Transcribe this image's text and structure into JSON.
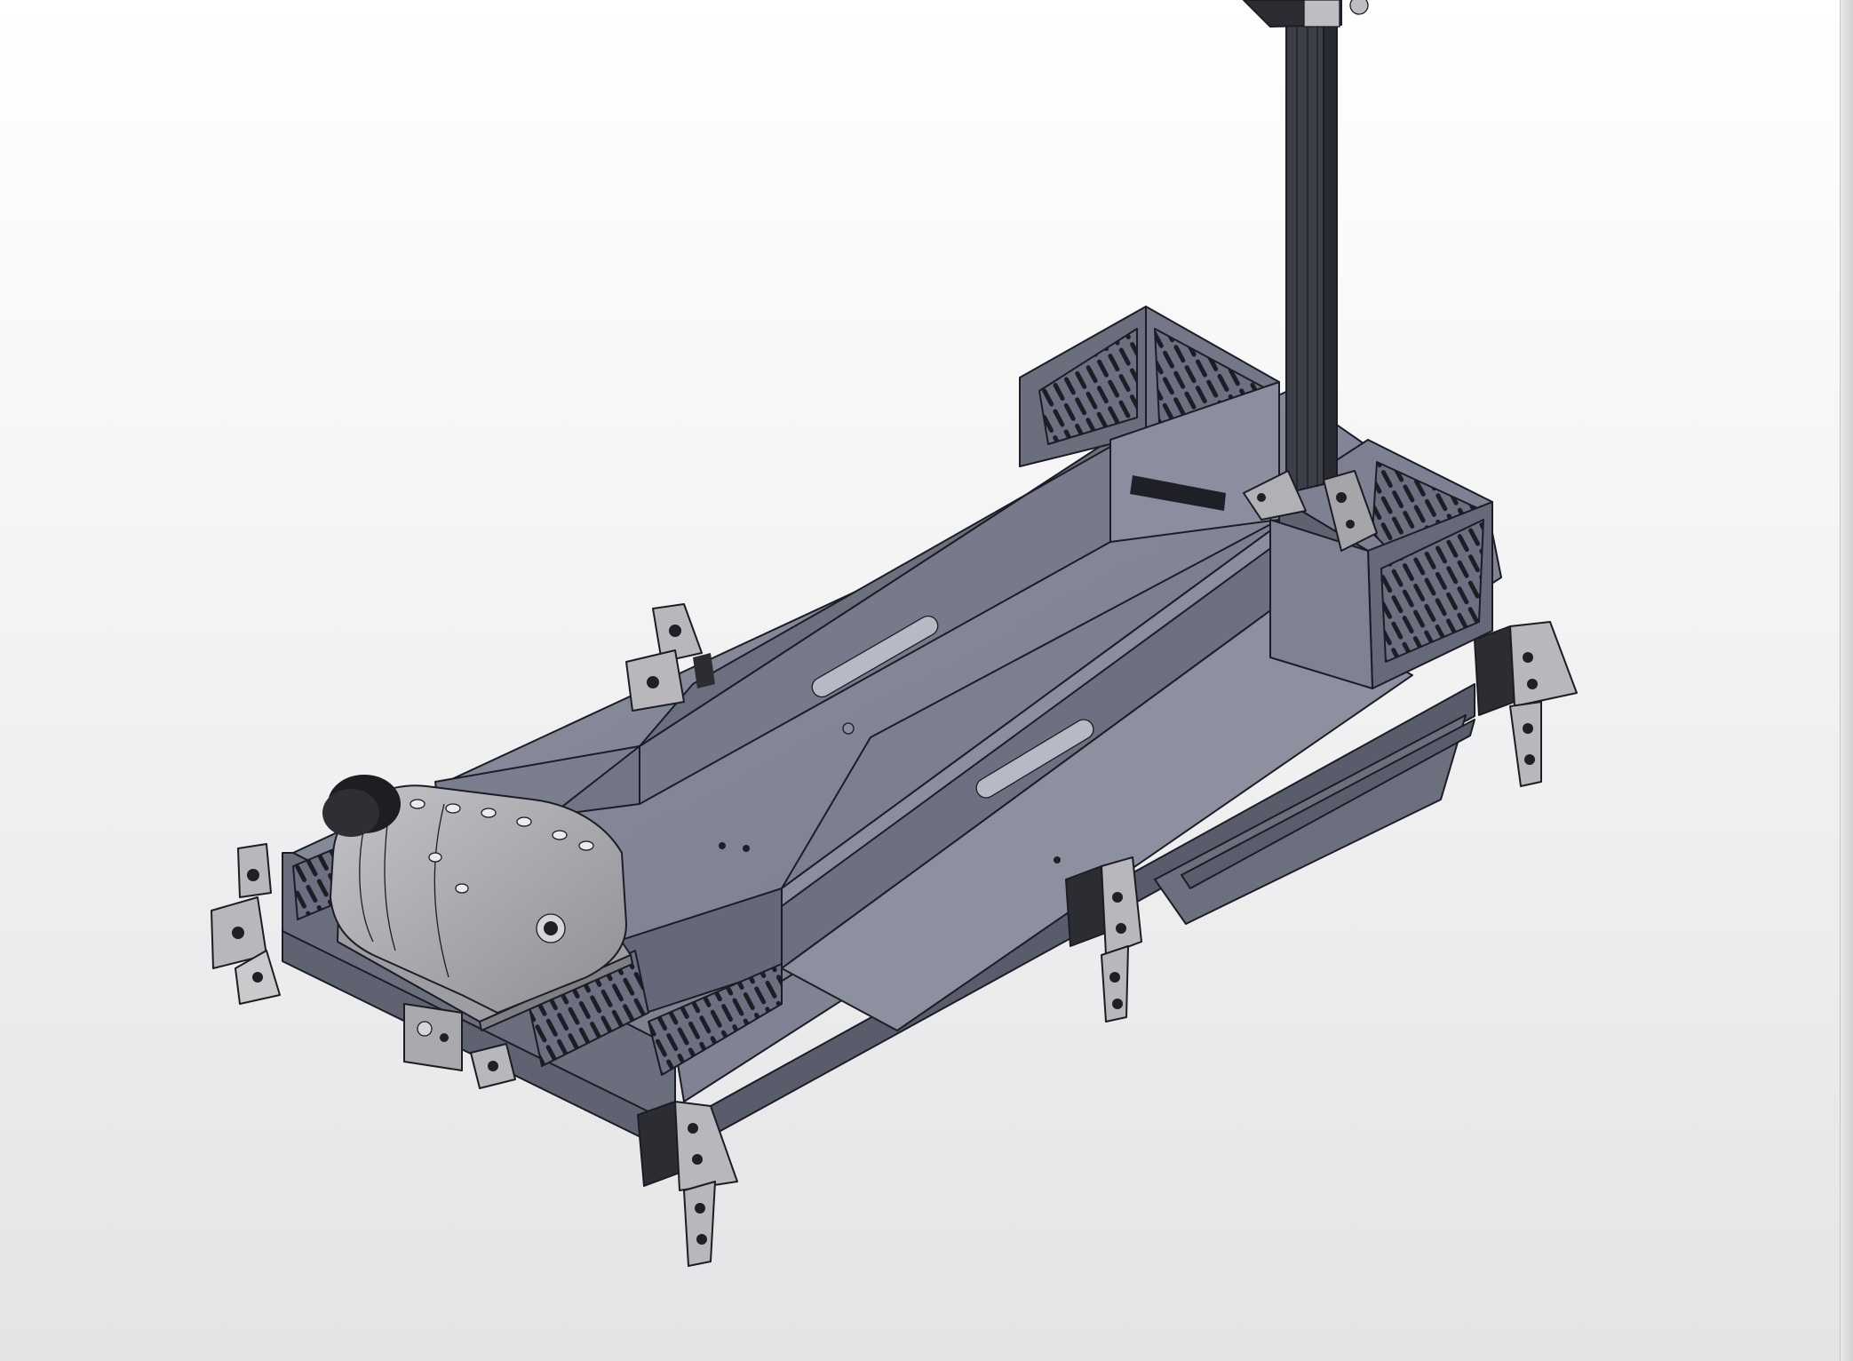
{
  "viewport": {
    "background_top": "#ffffff",
    "background_bottom": "#e4e4e6"
  },
  "model": {
    "colors": {
      "sheet_metal_light": "#7d8191",
      "sheet_metal_mid": "#6d7181",
      "sheet_metal_dark": "#555968",
      "wall_inner": "#8a8e9d",
      "bracket": "#b9b9bd",
      "motor_housing": "#a3a3a8",
      "edge": "#1c1d24"
    },
    "icons": [
      "motor-icon",
      "bracket-icon",
      "extrusion-icon"
    ]
  }
}
